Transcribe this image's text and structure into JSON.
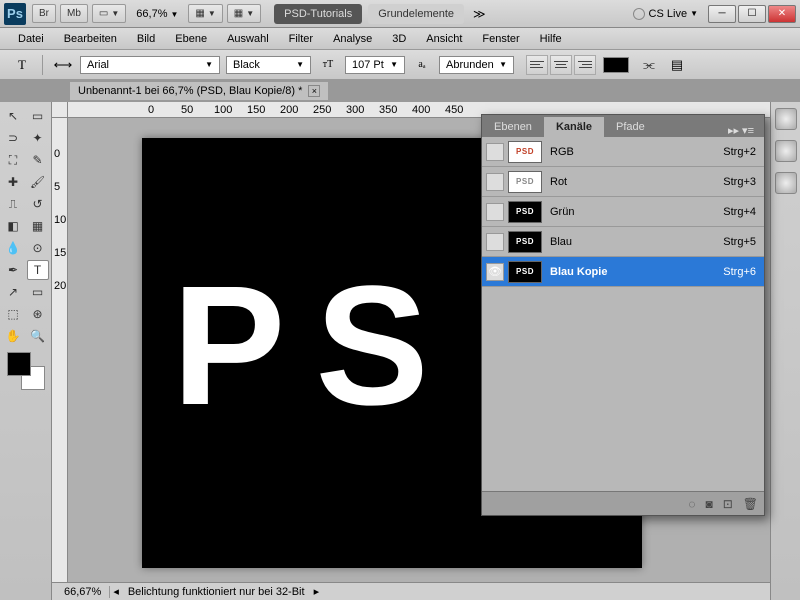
{
  "titlebar": {
    "br": "Br",
    "mb": "Mb",
    "zoom": "66,7%",
    "tutorials": "PSD-Tutorials",
    "grundelemente": "Grundelemente",
    "cslive": "CS Live"
  },
  "menu": [
    "Datei",
    "Bearbeiten",
    "Bild",
    "Ebene",
    "Auswahl",
    "Filter",
    "Analyse",
    "3D",
    "Ansicht",
    "Fenster",
    "Hilfe"
  ],
  "options": {
    "font": "Arial",
    "weight": "Black",
    "size": "107 Pt",
    "aa": "Abrunden"
  },
  "document": {
    "tab": "Unbenannt-1 bei 66,7% (PSD, Blau Kopie/8) *",
    "text": "PS"
  },
  "ruler_h": [
    "0",
    "50",
    "100",
    "150",
    "200",
    "250",
    "300",
    "350",
    "400",
    "450"
  ],
  "ruler_v": [
    "0",
    "5",
    "10",
    "15",
    "20"
  ],
  "panel": {
    "tabs": [
      "Ebenen",
      "Kanäle",
      "Pfade"
    ],
    "channels": [
      {
        "name": "RGB",
        "key": "Strg+2",
        "thumb": "rgb"
      },
      {
        "name": "Rot",
        "key": "Strg+3",
        "thumb": "grey"
      },
      {
        "name": "Grün",
        "key": "Strg+4",
        "thumb": "black"
      },
      {
        "name": "Blau",
        "key": "Strg+5",
        "thumb": "black"
      },
      {
        "name": "Blau Kopie",
        "key": "Strg+6",
        "thumb": "black",
        "selected": true,
        "eye": true
      }
    ]
  },
  "status": {
    "zoom": "66,67%",
    "info": "Belichtung funktioniert nur bei 32-Bit"
  },
  "thumb_text": "PSD"
}
